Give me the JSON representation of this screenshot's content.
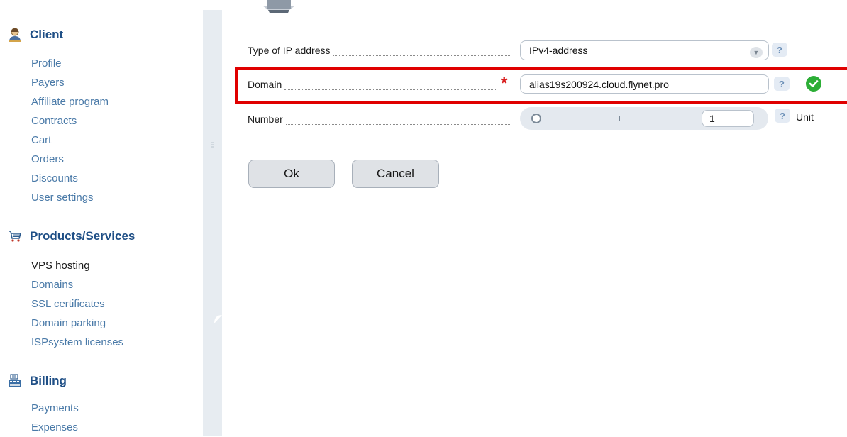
{
  "sidebar": {
    "client": {
      "title": "Client",
      "items": [
        "Profile",
        "Payers",
        "Affiliate program",
        "Contracts",
        "Cart",
        "Orders",
        "Discounts",
        "User settings"
      ]
    },
    "products": {
      "title": "Products/Services",
      "items": [
        "VPS hosting",
        "Domains",
        "SSL certificates",
        "Domain parking",
        "ISPsystem licenses"
      ],
      "active": "VPS hosting"
    },
    "billing": {
      "title": "Billing",
      "items": [
        "Payments",
        "Expenses"
      ]
    }
  },
  "form": {
    "ip_type": {
      "label": "Type of IP address",
      "value": "IPv4-address"
    },
    "domain": {
      "label": "Domain",
      "value": "alias19s200924.cloud.flynet.pro",
      "required_mark": "*"
    },
    "number": {
      "label": "Number",
      "value": "1",
      "unit": "Unit",
      "slider_level": 0
    },
    "help_glyph": "?",
    "ok_label": "Ok",
    "cancel_label": "Cancel"
  },
  "colors": {
    "link": "#4a7aa8",
    "heading": "#1f4f86",
    "highlight": "#e00000",
    "valid": "#2cae36"
  }
}
